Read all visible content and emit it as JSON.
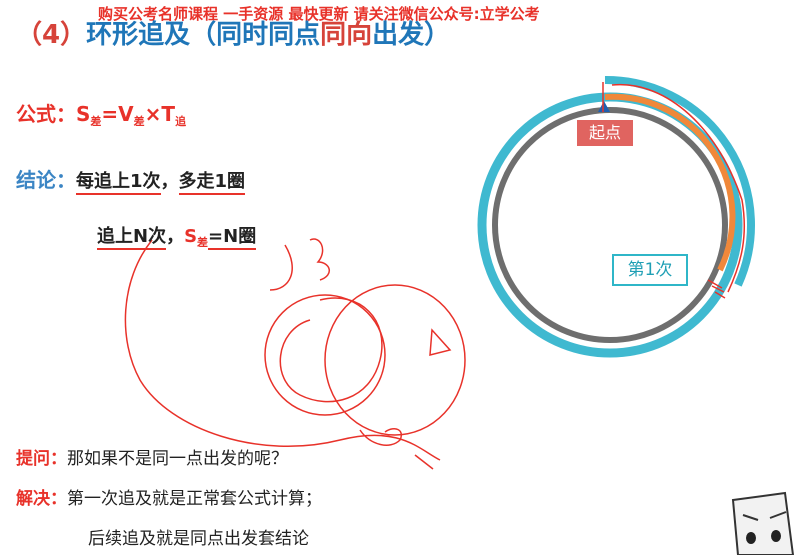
{
  "watermark": "购买公考名师课程 一手资源 最快更新 请关注微信公众号:立学公考",
  "heading": {
    "number": "（4）",
    "topic": "环形追及",
    "note_open": "（同时同点",
    "note_highlight": "同向",
    "note_close": "出发）"
  },
  "formula": {
    "label": "公式：",
    "s": "S",
    "s_sub": "差",
    "eq": "=",
    "v": "V",
    "v_sub": "差",
    "times": "×",
    "t": "T",
    "t_sub": "追"
  },
  "conclusion": {
    "label": "结论：",
    "line1_a": "每追上1次",
    "line1_sep": "，",
    "line1_b": "多走1圈",
    "line2_a": "追上N次",
    "line2_sep": "，",
    "line2_s": "S",
    "line2_s_sub": "差",
    "line2_tail": "=N圈"
  },
  "question": {
    "label": "提问：",
    "text": "那如果不是同一点出发的呢？"
  },
  "answer": {
    "label": "解决：",
    "line1": "第一次追及就是正常套公式计算；",
    "line2": "后续追及就是同点出发套结论"
  },
  "diagram": {
    "start_label": "起点",
    "first_catch_label": "第1次",
    "colors": {
      "outer_track": "#3fb9d0",
      "inner_track": "#6e6e6e",
      "slow_runner": "#f0883a",
      "start_badge": "#e06460",
      "annotation": "#e8322a"
    }
  }
}
